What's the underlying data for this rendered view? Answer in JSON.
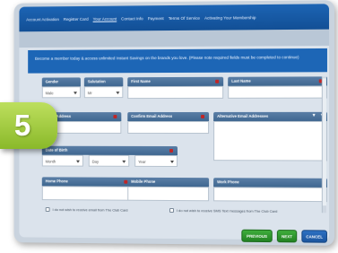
{
  "tabs": [
    {
      "label": "Account Activation"
    },
    {
      "label": "Register Card"
    },
    {
      "label": "Your Account"
    },
    {
      "label": "Contact Info"
    },
    {
      "label": "Payment"
    },
    {
      "label": "Terms Of Service"
    },
    {
      "label": "Activating Your Membership"
    }
  ],
  "intro_text": "Become a member today & access unlimited Instant Savings on the brands you love. (Please note required fields must be completed to continue)",
  "step_number": "5",
  "fields": {
    "gender": {
      "label": "Gender",
      "value": "Male"
    },
    "salutation": {
      "label": "Salutation",
      "value": "Mr"
    },
    "first_name": {
      "label": "First Name"
    },
    "last_name": {
      "label": "Last Name"
    },
    "email": {
      "label": "Email Address"
    },
    "confirm_email": {
      "label": "Confirm Email Address"
    },
    "alt_emails": {
      "label": "Alternative Email Addresses"
    },
    "dob": {
      "label": "Date of Birth",
      "month": "Month",
      "day": "Day",
      "year": "Year"
    },
    "home_phone": {
      "label": "Home Phone"
    },
    "mobile_phone": {
      "label": "Mobile Phone"
    },
    "work_phone": {
      "label": "Work Phone"
    }
  },
  "checkbox_email": "I do not wish to receive email from The Club Card",
  "checkbox_sms": "I do not wish to receive SMS Text messages from The Club Card",
  "buttons": {
    "previous": "PREVIOUS",
    "next": "NEXT",
    "cancel": "CANCEL"
  },
  "colors": {
    "accent": "#1d66b6",
    "badge": "#9cc83a",
    "next": "#2f9a2f"
  }
}
